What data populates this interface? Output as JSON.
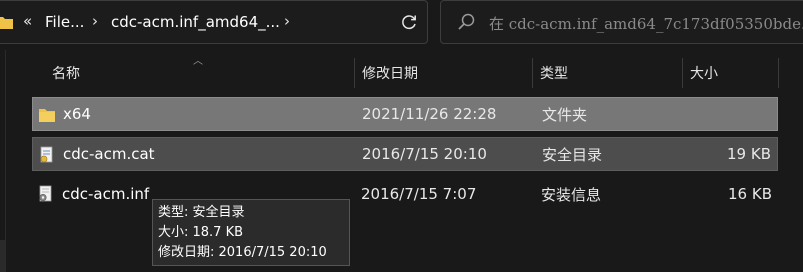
{
  "address": {
    "back_chevron": "«",
    "crumbs": [
      "File...",
      "cdc-acm.inf_amd64_..."
    ],
    "separator": "›"
  },
  "search": {
    "placeholder": "在 cdc-acm.inf_amd64_7c173df05350bde..."
  },
  "columns": {
    "name": "名称",
    "date": "修改日期",
    "type": "类型",
    "size": "大小"
  },
  "rows": [
    {
      "name": "x64",
      "date": "2021/11/26 22:28",
      "type": "文件夹",
      "size": "",
      "icon": "folder-icon"
    },
    {
      "name": "cdc-acm.cat",
      "date": "2016/7/15 20:10",
      "type": "安全目录",
      "size": "19 KB",
      "icon": "security-catalog-icon"
    },
    {
      "name": "cdc-acm.inf",
      "date": "2016/7/15 7:07",
      "type": "安装信息",
      "size": "16 KB",
      "icon": "setup-info-icon"
    }
  ],
  "tooltip": {
    "type_line": "类型: 安全目录",
    "size_line": "大小: 18.7 KB",
    "date_line": "修改日期: 2016/7/15 20:10"
  },
  "colors": {
    "background": "#191919",
    "selected_row": "#777777",
    "hover_row": "#4d4d4d",
    "folder": "#f0c246"
  }
}
